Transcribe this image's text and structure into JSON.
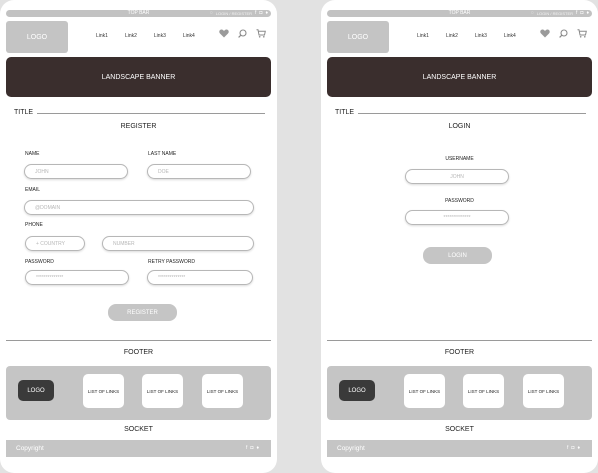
{
  "topbar": {
    "title": "TOP BAR",
    "account": "LOGIN / REGISTER"
  },
  "header": {
    "logo": "LOGO",
    "links": [
      "Link1",
      "Link2",
      "Link3",
      "Link4"
    ]
  },
  "banner": {
    "label": "LANDSCAPE BANNER"
  },
  "section": {
    "title": "TITLE"
  },
  "register": {
    "heading": "REGISTER",
    "name_label": "NAME",
    "name_placeholder": "JOHN",
    "lastname_label": "LAST NAME",
    "lastname_placeholder": "DOE",
    "email_label": "EMAIL",
    "email_placeholder": "@DOMAIN",
    "phone_label": "PHONE",
    "country_placeholder": "+ COUNTRY",
    "number_placeholder": "NUMBER",
    "password_label": "PASSWORD",
    "password_value": "**************",
    "retry_label": "RETRY PASSWORD",
    "retry_value": "**************",
    "submit": "REGISTER"
  },
  "login": {
    "heading": "LOGIN",
    "username_label": "USERNAME",
    "username_placeholder": "JOHN",
    "password_label": "PASSWORD",
    "password_value": "**************",
    "submit": "LOGIN"
  },
  "footer": {
    "title": "FOOTER",
    "logo": "LOGO",
    "lists": [
      "LIST OF LINKS",
      "LIST OF LINKS",
      "LIST OF LINKS"
    ]
  },
  "socket": {
    "title": "SOCKET",
    "copyright": "Copyright"
  },
  "icons": {
    "social": [
      "facebook-icon",
      "instagram-icon",
      "twitter-icon"
    ],
    "header": [
      "heart-icon",
      "search-icon",
      "cart-icon"
    ]
  },
  "colors": {
    "banner": "#3a2e2d",
    "placeholder_grey": "#c4c4c4",
    "footer_logo": "#3a3a3a",
    "page_background": "#e2e2e2"
  }
}
